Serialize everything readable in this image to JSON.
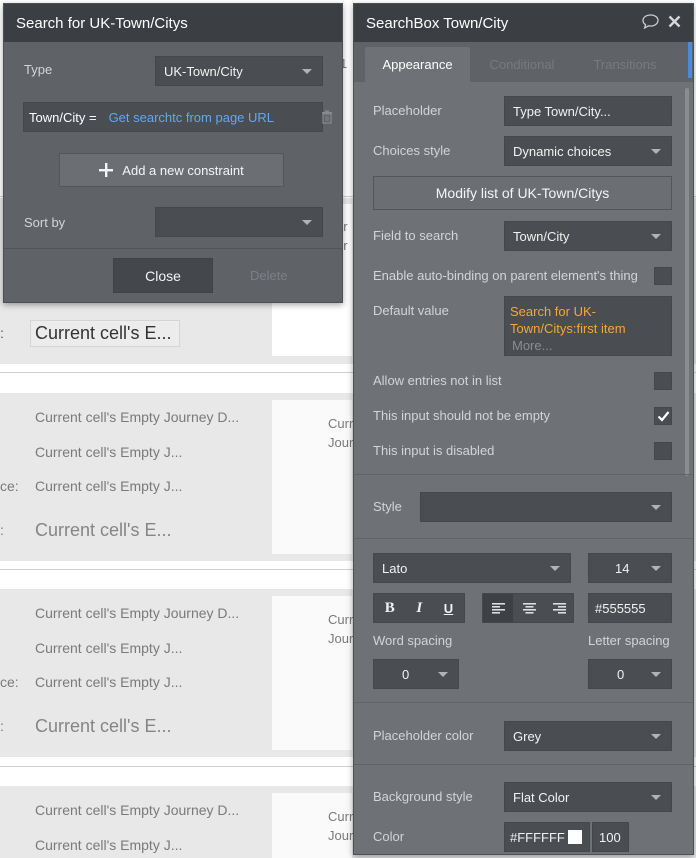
{
  "background": {
    "row_texts": {
      "peek_a": "1",
      "peek_b": "ar",
      "peek_c": "ur",
      "colon": ":",
      "current_cell_big": "Current cell's E...",
      "journey_d": "Current cell's Empty Journey D...",
      "journey_j": "Current cell's Empty J...",
      "curr": "Curr",
      "jour": "Jour",
      "ce": "ce:"
    }
  },
  "search_panel": {
    "title": "Search for UK-Town/Citys",
    "type_label": "Type",
    "type_value": "UK-Town/City",
    "constraint_key": "Town/City =",
    "constraint_value": "Get searchtc from page URL",
    "add_constraint_label": "Add a new constraint",
    "sort_by_label": "Sort by",
    "sort_by_value": "",
    "close_label": "Close",
    "delete_label": "Delete"
  },
  "property_panel": {
    "title": "SearchBox Town/City",
    "tabs": [
      "Appearance",
      "Conditional",
      "Transitions"
    ],
    "placeholder_label": "Placeholder",
    "placeholder_value": "Type Town/City...",
    "choices_style_label": "Choices style",
    "choices_style_value": "Dynamic choices",
    "modify_list_label": "Modify list of UK-Town/Citys",
    "field_to_search_label": "Field to search",
    "field_to_search_value": "Town/City",
    "auto_binding_label": "Enable auto-binding on parent element's thing",
    "default_value_label": "Default value",
    "default_value_line1": "Search for UK-",
    "default_value_line2": "Town/Citys:first item",
    "default_value_more": "More...",
    "allow_entries_label": "Allow entries not in list",
    "not_empty_label": "This input should not be empty",
    "disabled_label": "This input is disabled",
    "style_label": "Style",
    "style_value": "",
    "font_family_value": "Lato",
    "font_size_value": "14",
    "bold_glyph": "B",
    "italic_glyph": "I",
    "underline_glyph": "U",
    "font_color_value": "#555555",
    "word_spacing_label": "Word spacing",
    "word_spacing_value": "0",
    "letter_spacing_label": "Letter spacing",
    "letter_spacing_value": "0",
    "placeholder_color_label": "Placeholder color",
    "placeholder_color_value": "Grey",
    "background_style_label": "Background style",
    "background_style_value": "Flat Color",
    "color_label": "Color",
    "color_hex_value": "#FFFFFF",
    "color_opacity_value": "100"
  },
  "states": {
    "auto_binding_checked": false,
    "allow_entries_checked": false,
    "not_empty_checked": true,
    "disabled_checked": false
  },
  "colors": {
    "panel_bg": "#5f6267",
    "header_bg": "#3b3e42",
    "field_bg": "#4a4d51",
    "link_blue": "#63a7f2",
    "expression_orange": "#f2a838",
    "accent_blue": "#4e89d9"
  },
  "icons": {
    "plus": "plus-icon",
    "trash": "trash-icon",
    "comment": "comment-icon",
    "close": "close-icon",
    "check": "checkmark-icon"
  }
}
